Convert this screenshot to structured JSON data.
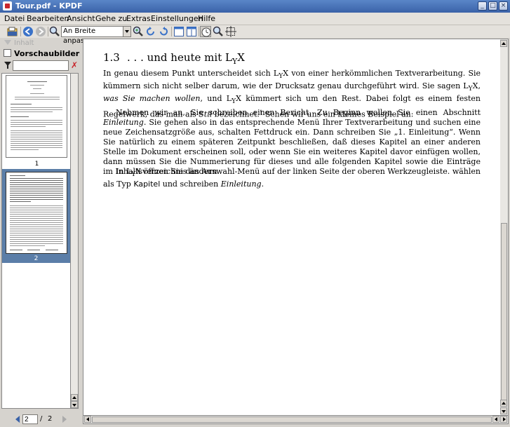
{
  "window": {
    "title": "Tour.pdf - KPDF"
  },
  "menu": [
    "Datei",
    "Bearbeiten",
    "Ansicht",
    "Gehe zu",
    "Extras",
    "Einstellungen",
    "Hilfe"
  ],
  "toolbar": {
    "zoom_value": "An Breite anpassen"
  },
  "sidebar": {
    "tab_inactive": "Inhalt",
    "tab_active": "Vorschaubilder",
    "filter_value": "",
    "thumbnails": [
      {
        "label": "1",
        "selected": false
      },
      {
        "label": "2",
        "selected": true
      }
    ]
  },
  "pagenav": {
    "current": "2",
    "separator": "/",
    "total": "2"
  },
  "document": {
    "section_number": "1.3",
    "section_title": ". . . und heute mit L",
    "section_title_tail": "X",
    "p1": {
      "a": "In genau diesem Punkt unterscheidet sich L",
      "b": "X von einer herkömmlichen Textverarbeitung. Sie kümmern sich nicht selber darum, wie der Drucksatz genau durchgeführt wird. Sie sagen L",
      "c": "X, ",
      "em1": "was Sie machen wollen",
      "d": ", und L",
      "e": "X kümmert sich um den Rest. Dabei folgt es einem festen Regelwerk, das man als ",
      "em2": "Stil",
      "f": " bezeichnet.",
      "sup": "1",
      "g": " Schen wir uns ein kleines Beispiel an:"
    },
    "p2": {
      "a": "Nehmen wir an, Sie schreiben einen Bericht. Zu Beginn wollen Sie einen Abschnitt ",
      "em1": "Einleitung",
      "b": ". Sie gehen also in das entsprechende Menü Ihrer Textverarbeitung und suchen eine neue Zeichensatzgröße aus, schalten Fettdruck ein. Dann schreiben Sie „1. Einleitung“. Wenn Sie natürlich zu einem späteren Zeitpunkt beschließen, daß dieses Kapitel an einer anderen Stelle im Dokument erscheinen soll, oder wenn Sie ein weiteres Kapitel davor einfügen wollen, dann müssen Sie die Nummerierung für dieses und alle folgenden Kapitel sowie die Einträge im Inhaltsverzeichnis ändern."
    },
    "p3": {
      "a": "In L",
      "b": "X öffnen Sie das Auswahl-Menü auf der linken Seite der oberen Werkzeugleiste. wählen als Typ ",
      "sf": "Kapitel",
      "c": " und schreiben ",
      "em1": "Einleitung",
      "d": "."
    },
    "yx_y": "Y"
  },
  "colors": {
    "titlebar": "#3a62a8",
    "selection": "#5b7ea8",
    "accent_red": "#c8262c"
  },
  "icons": [
    "open-icon",
    "back-icon",
    "forward-icon",
    "zoom-icon",
    "zoom-in-icon",
    "rotate-left-icon",
    "rotate-right-icon",
    "single-page-icon",
    "two-page-icon",
    "browse-tool-icon",
    "zoom-tool-icon",
    "select-tool-icon"
  ]
}
